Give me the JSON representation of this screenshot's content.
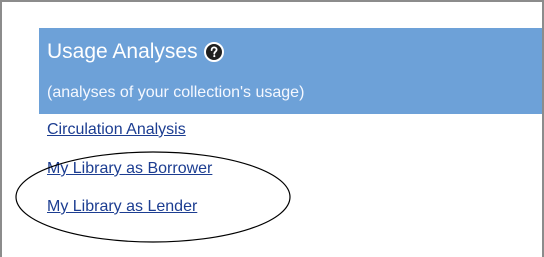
{
  "panel": {
    "title": "Usage Analyses",
    "subtitle": "(analyses of your collection's usage)",
    "header_color": "#6da1d8",
    "help_icon": "help-icon"
  },
  "links": [
    {
      "label": "Circulation Analysis"
    },
    {
      "label": "My Library as Borrower"
    },
    {
      "label": "My Library as Lender"
    }
  ],
  "annotation": {
    "shape": "ellipse",
    "color": "#000000",
    "encircles": [
      "My Library as Borrower",
      "My Library as Lender"
    ]
  }
}
